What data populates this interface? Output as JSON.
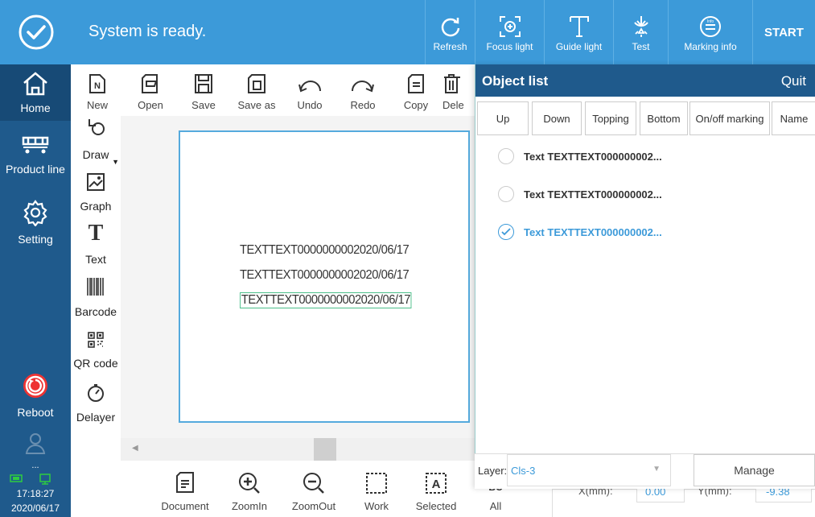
{
  "header": {
    "status": "System is ready.",
    "buttons": [
      {
        "name": "refresh",
        "label": "Refresh",
        "icon": "refresh-icon"
      },
      {
        "name": "focus-light",
        "label": "Focus light",
        "icon": "focus-icon"
      },
      {
        "name": "guide-light",
        "label": "Guide light",
        "icon": "guide-light-icon"
      },
      {
        "name": "test",
        "label": "Test",
        "icon": "test-icon"
      },
      {
        "name": "marking-info",
        "label": "Marking info",
        "icon": "info-icon",
        "badge": "Info"
      }
    ],
    "start": "START"
  },
  "sidebar": {
    "items": [
      {
        "label": "Home",
        "icon": "home-icon",
        "active": true
      },
      {
        "label": "Product line",
        "icon": "product-line-icon"
      },
      {
        "label": "Setting",
        "icon": "gear-icon"
      },
      {
        "label": "Reboot",
        "icon": "reboot-icon"
      }
    ],
    "user": "...",
    "time": "17:18:27",
    "date": "2020/06/17"
  },
  "toolbar": {
    "items": [
      {
        "label": "New",
        "icon": "new-file-icon",
        "letter": "N"
      },
      {
        "label": "Open",
        "icon": "open-icon"
      },
      {
        "label": "Save",
        "icon": "save-icon"
      },
      {
        "label": "Save as",
        "icon": "save-as-icon"
      },
      {
        "label": "Undo",
        "icon": "undo-icon"
      },
      {
        "label": "Redo",
        "icon": "redo-icon"
      },
      {
        "label": "Copy",
        "icon": "copy-icon"
      },
      {
        "label": "Dele",
        "icon": "delete-icon"
      }
    ]
  },
  "tools": {
    "items": [
      {
        "label": "Draw",
        "icon": "draw-icon"
      },
      {
        "label": "Graph",
        "icon": "graph-icon"
      },
      {
        "label": "Text",
        "icon": "text-icon",
        "glyph": "T"
      },
      {
        "label": "Barcode",
        "icon": "barcode-icon"
      },
      {
        "label": "QR code",
        "icon": "qr-code-icon"
      },
      {
        "label": "Delayer",
        "icon": "timer-icon"
      }
    ]
  },
  "canvas": {
    "lines": [
      "TEXTTEXT0000000002020/06/17",
      "TEXTTEXT0000000002020/06/17",
      "TEXTTEXT0000000002020/06/17"
    ]
  },
  "bottom": {
    "items": [
      {
        "label": "Document",
        "icon": "document-icon"
      },
      {
        "label": "ZoomIn",
        "icon": "zoom-in-icon"
      },
      {
        "label": "ZoomOut",
        "icon": "zoom-out-icon"
      },
      {
        "label": "Work",
        "icon": "work-icon"
      },
      {
        "label": "Selected",
        "icon": "selected-icon",
        "glyph": "A"
      },
      {
        "label": "All",
        "icon": "all-icon",
        "glyph": "BC"
      }
    ],
    "x_label": "X(mm):",
    "x_value": "0.00",
    "y_label": "Y(mm):",
    "y_value": "-9.38"
  },
  "object_list": {
    "title": "Object list",
    "quit": "Quit",
    "buttons": [
      "Up",
      "Down",
      "Topping",
      "Bottom",
      "On/off marking",
      "Name"
    ],
    "objects": [
      {
        "label": "Text TEXTTEXT000000002...",
        "selected": false
      },
      {
        "label": "Text TEXTTEXT000000002...",
        "selected": false
      },
      {
        "label": "Text TEXTTEXT000000002...",
        "selected": true
      }
    ],
    "layer_label": "Layer:",
    "layer_value": "Cls-3",
    "manage": "Manage"
  },
  "colors": {
    "header": "#3c9ad9",
    "sidebar": "#1f5a8c",
    "selected": "#3c9ad9",
    "canvas_border": "#55aadd"
  }
}
